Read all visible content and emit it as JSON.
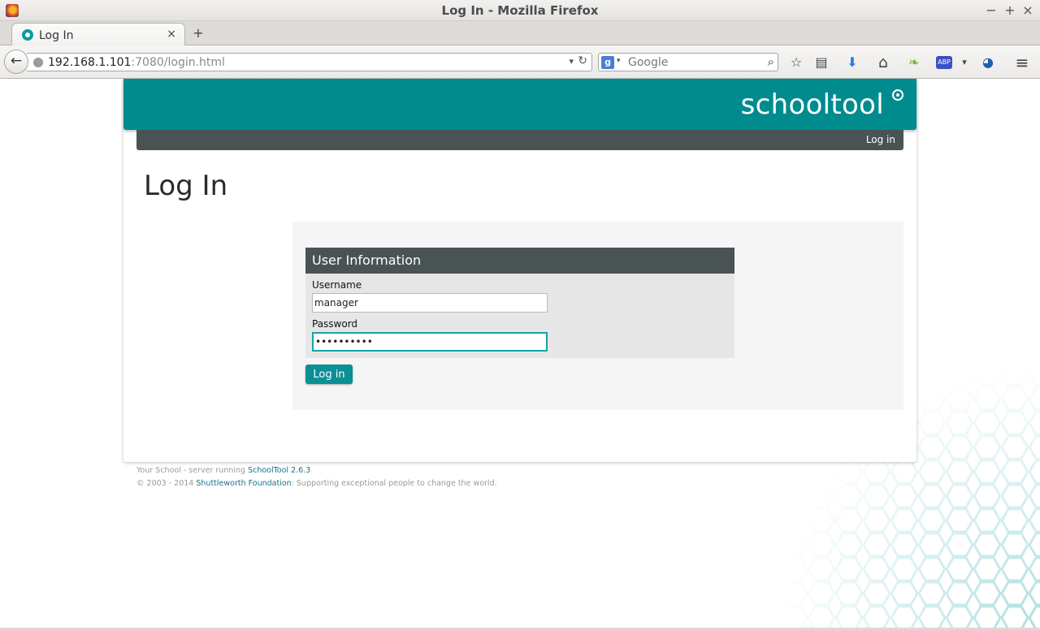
{
  "window": {
    "title": "Log In - Mozilla Firefox",
    "minimize": "−",
    "maximize": "+",
    "close": "×"
  },
  "tabs": [
    {
      "label": "Log In",
      "close": "×"
    }
  ],
  "new_tab": "+",
  "nav": {
    "back": "←",
    "url_host": "192.168.1.101",
    "url_rest": ":7080/login.html",
    "url_dropdown": "▾",
    "reload": "↻",
    "search_engine_letter": "g",
    "search_engine_caret": "▾",
    "search_placeholder": "Google",
    "search_glass": "⌕",
    "toolbar": {
      "bookmark": "☆",
      "reading_list": "▤",
      "downloads": "⬇",
      "home": "⌂",
      "leaf": "❧",
      "abp": "ABP",
      "abp_caret": "▾",
      "profile": "◕",
      "menu": "≡"
    }
  },
  "site": {
    "brand": "schooltool",
    "menu_login": "Log in",
    "page_title": "Log In",
    "form": {
      "legend": "User Information",
      "username_label": "Username",
      "username_value": "manager",
      "password_label": "Password",
      "password_value": "••••••••••",
      "submit": "Log in"
    },
    "footer": {
      "line1_prefix": "Your School - server running ",
      "line1_link": "SchoolTool 2.6.3",
      "line2_prefix": "© 2003 - 2014 ",
      "line2_link": "Shuttleworth Foundation",
      "line2_suffix": ": Supporting exceptional people to change the world."
    }
  },
  "colors": {
    "brand_teal": "#008b8f",
    "menu_dark": "#4a5354",
    "focus_teal": "#13a4a9"
  }
}
